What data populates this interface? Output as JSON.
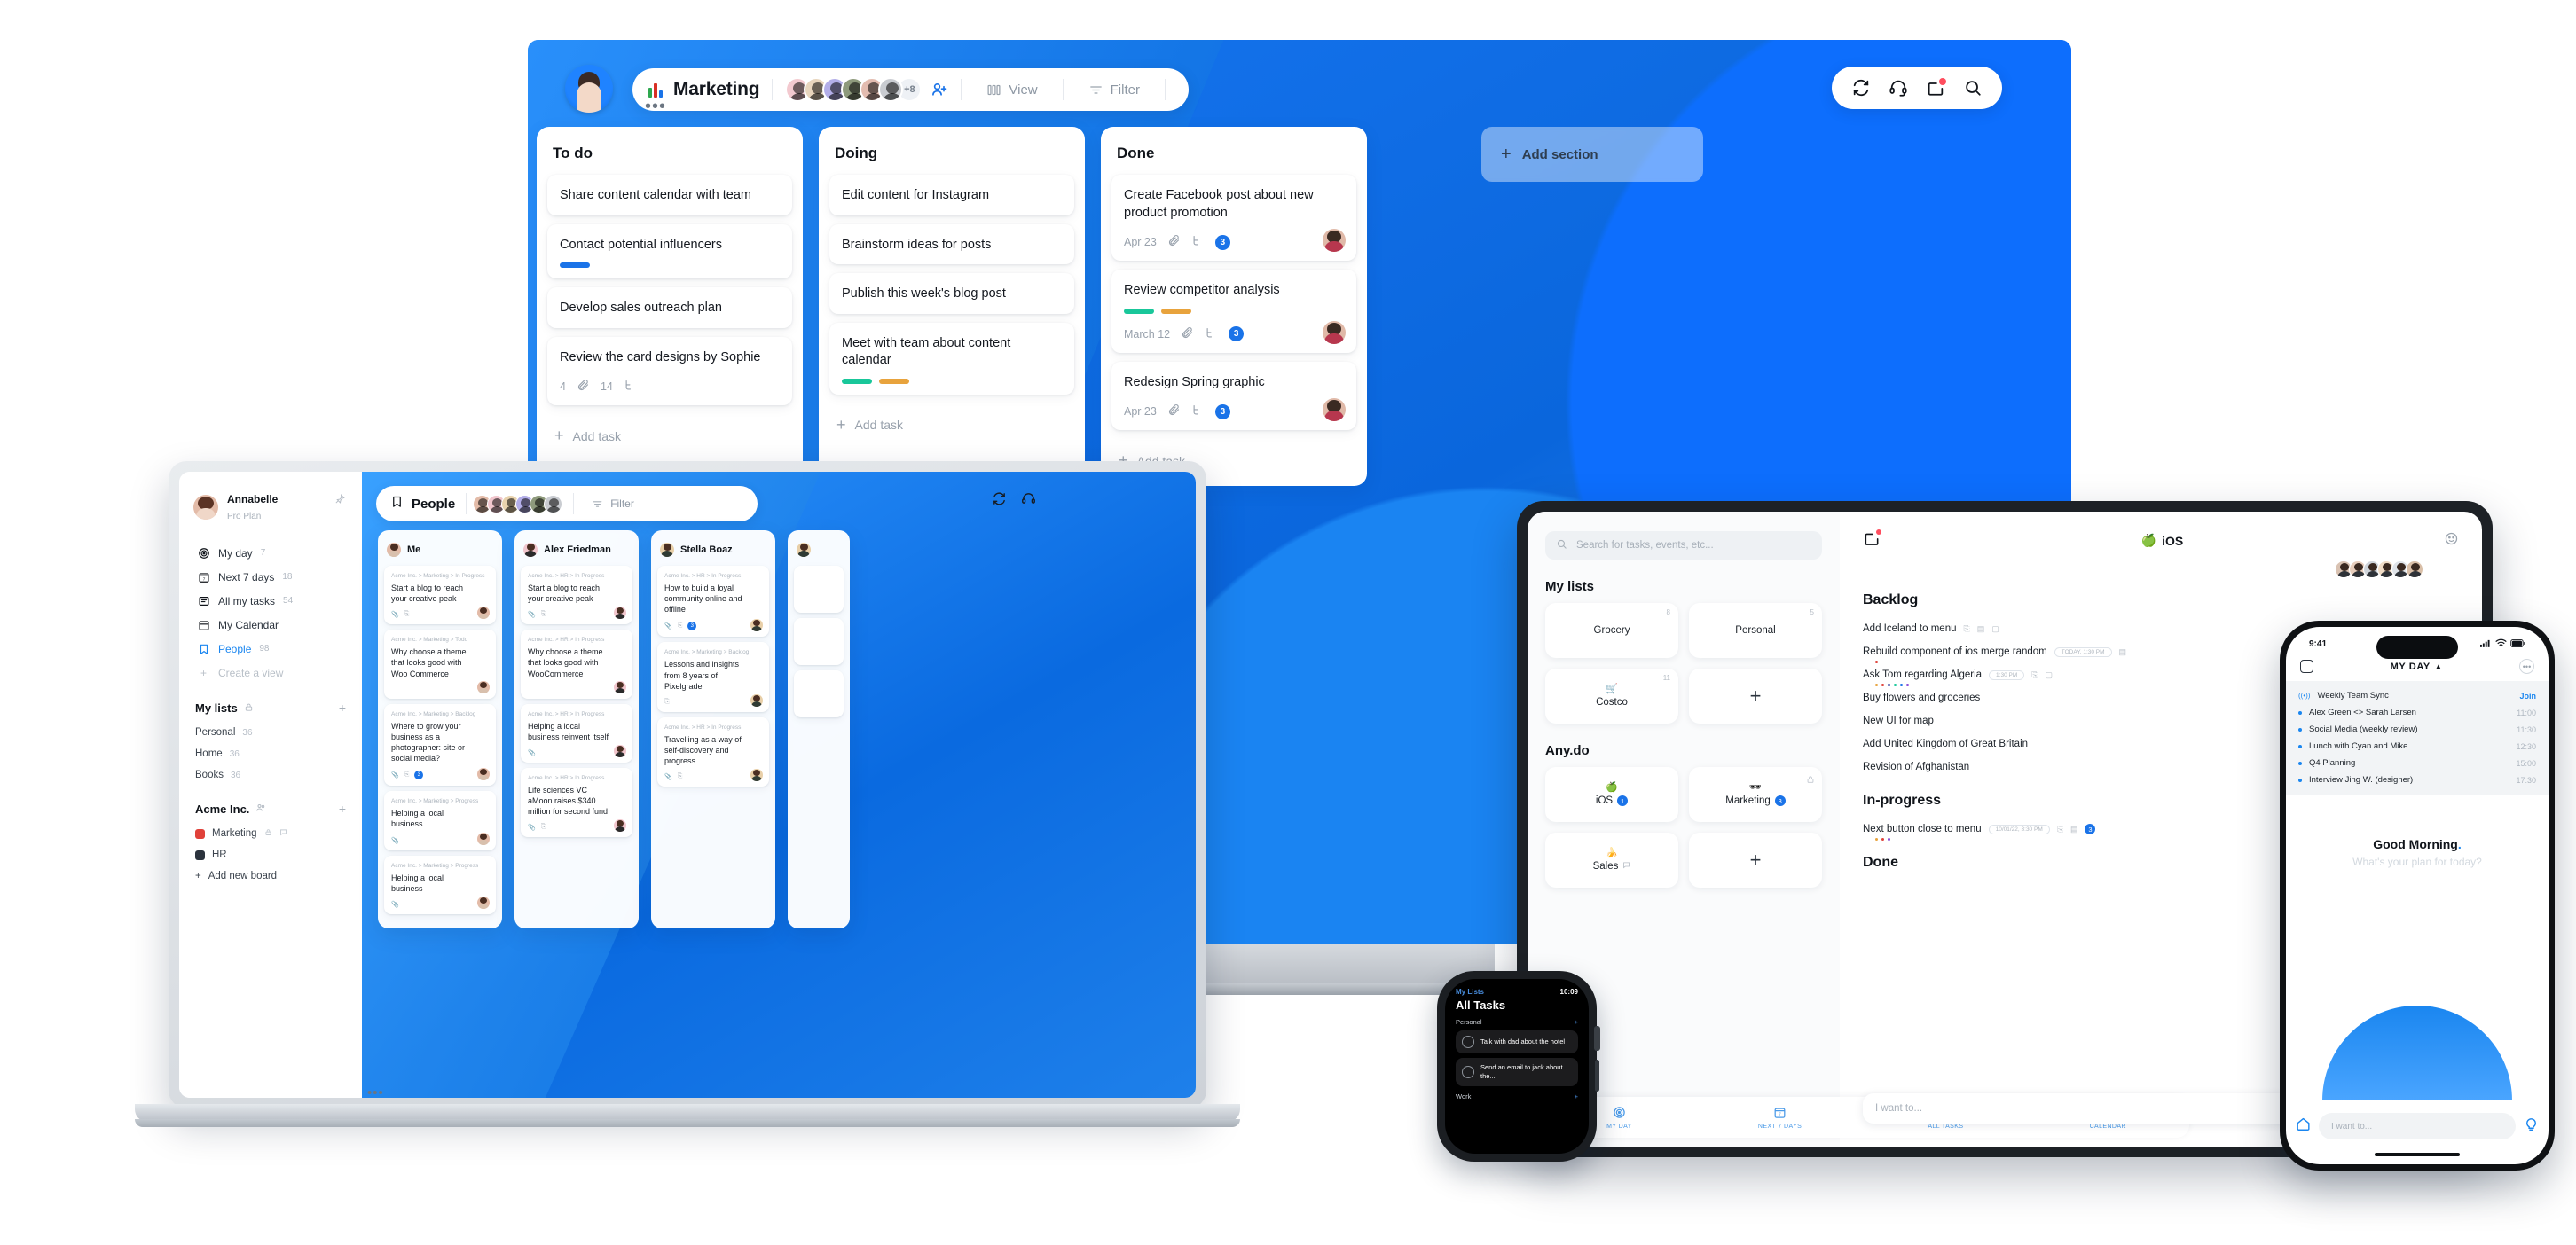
{
  "desktop": {
    "toolbar": {
      "board_title": "Marketing",
      "board_icon": "bar-chart-icon",
      "avatar_overflow": "+8",
      "add_person_icon": "add-person-icon",
      "view_label": "View",
      "filter_label": "Filter",
      "more_label": "•••"
    },
    "right_tools": [
      {
        "icon": "sync-icon",
        "name": "sync"
      },
      {
        "icon": "headset-icon",
        "name": "support"
      },
      {
        "icon": "inbox-icon",
        "name": "notifications"
      },
      {
        "icon": "search-icon",
        "name": "search"
      }
    ],
    "add_section_label": "Add section",
    "columns": [
      {
        "title": "To do",
        "cards": [
          {
            "title": "Share content calendar with team"
          },
          {
            "title": "Contact potential influencers",
            "chips": [
              "#1a73e8"
            ]
          },
          {
            "title": "Develop sales outreach plan"
          },
          {
            "title": "Review the card designs by Sophie",
            "meta": [
              "4",
              "14"
            ]
          }
        ],
        "add_label": "Add task"
      },
      {
        "title": "Doing",
        "cards": [
          {
            "title": "Edit content for Instagram"
          },
          {
            "title": "Brainstorm ideas for posts"
          },
          {
            "title": "Publish this week's blog post"
          },
          {
            "title": "Meet with team about content calendar",
            "chips": [
              "#19c79a",
              "#e8a33d"
            ]
          }
        ],
        "add_label": "Add task"
      },
      {
        "title": "Done",
        "cards": [
          {
            "title": "Create Facebook post about new product promotion",
            "date": "Apr 23",
            "comments": "3"
          },
          {
            "title": "Review competitor analysis",
            "chips": [
              "#19c79a",
              "#e8a33d"
            ],
            "date": "March 12",
            "comments": "3"
          },
          {
            "title": "Redesign Spring graphic",
            "date": "Apr 23",
            "comments": "3"
          }
        ],
        "add_label": "Add task"
      }
    ]
  },
  "laptop": {
    "sidebar": {
      "user_name": "Annabelle",
      "user_plan": "Pro Plan",
      "views": [
        {
          "label": "My day",
          "count": "7",
          "icon": "target-icon"
        },
        {
          "label": "Next 7 days",
          "count": "18",
          "icon": "calendar-7-icon"
        },
        {
          "label": "All my tasks",
          "count": "54",
          "icon": "list-icon"
        },
        {
          "label": "My Calendar",
          "count": "",
          "icon": "calendar-icon"
        },
        {
          "label": "People",
          "count": "98",
          "icon": "bookmark-icon"
        }
      ],
      "create_view_label": "Create a view",
      "my_lists_title": "My lists",
      "my_lists": [
        {
          "label": "Personal",
          "count": "36"
        },
        {
          "label": "Home",
          "count": "36"
        },
        {
          "label": "Books",
          "count": "36"
        }
      ],
      "workspace_title": "Acme Inc.",
      "boards": [
        {
          "label": "Marketing",
          "color": "#e0413a"
        },
        {
          "label": "HR",
          "color": "#2b333d"
        }
      ],
      "add_board_label": "Add new board"
    },
    "topbar": {
      "title": "People",
      "title_icon": "bookmark-icon",
      "filter_label": "Filter",
      "more_label": "•••"
    },
    "people": [
      {
        "name": "Me",
        "cards": [
          {
            "crumb": "Acme Inc. > Marketing > In Progress",
            "title": "Start a blog to reach your creative peak",
            "icons": [
              "attachment-icon",
              "subtask-icon"
            ]
          },
          {
            "crumb": "Acme Inc. > Marketing > Todo",
            "title": "Why choose a theme that looks good with Woo Commerce",
            "icons": []
          },
          {
            "crumb": "Acme Inc. > Marketing > Backlog",
            "title": "Where to grow your business as a photographer: site or social media?",
            "icons": [
              "attachment-icon",
              "subtask-icon"
            ],
            "badge": "3"
          },
          {
            "crumb": "Acme Inc. > Marketing > Progress",
            "title": "Helping a local business",
            "icons": [
              "attachment-icon"
            ]
          },
          {
            "crumb": "Acme Inc. > Marketing > Progress",
            "title": "Helping a local business",
            "icons": [
              "attachment-icon"
            ]
          }
        ]
      },
      {
        "name": "Alex Friedman",
        "cards": [
          {
            "crumb": "Acme Inc. > HR > In Progress",
            "title": "Start a blog to reach your creative peak",
            "icons": [
              "attachment-icon",
              "subtask-icon"
            ]
          },
          {
            "crumb": "Acme Inc. > HR > In Progress",
            "title": "Why choose a theme that looks good with WooCommerce",
            "icons": []
          },
          {
            "crumb": "Acme Inc. > HR > In Progress",
            "title": "Helping a local business reinvent itself",
            "icons": [
              "attachment-icon"
            ]
          },
          {
            "crumb": "Acme Inc. > HR > In Progress",
            "title": "Life sciences VC aMoon raises $340 million for second fund",
            "icons": [
              "attachment-icon",
              "subtask-icon"
            ]
          }
        ]
      },
      {
        "name": "Stella Boaz",
        "cards": [
          {
            "crumb": "Acme Inc. > HR > In Progress",
            "title": "How to build a loyal community online and offline",
            "icons": [
              "attachment-icon",
              "subtask-icon"
            ],
            "badge": "3"
          },
          {
            "crumb": "Acme Inc. > Marketing > Backlog",
            "title": "Lessons and insights from 8 years of Pixelgrade",
            "icons": [
              "subtask-icon"
            ]
          },
          {
            "crumb": "Acme Inc. > HR > In Progress",
            "title": "Travelling as a way of self-discovery and progress",
            "icons": [
              "attachment-icon",
              "subtask-icon"
            ]
          }
        ]
      }
    ]
  },
  "tablet": {
    "search_placeholder": "Search for tasks, events, etc...",
    "my_lists_title": "My lists",
    "my_lists": [
      {
        "label": "Grocery",
        "count": "8",
        "emoji": ""
      },
      {
        "label": "Personal",
        "count": "5",
        "emoji": ""
      },
      {
        "label": "Costco",
        "count": "11",
        "emoji": "🛒"
      },
      {
        "label": "",
        "count": "",
        "emoji": "",
        "add": true
      }
    ],
    "anydo_title": "Any.do",
    "anydo_lists": [
      {
        "label": "iOS",
        "emoji": "🍏",
        "badge": "1"
      },
      {
        "label": "Marketing",
        "emoji": "🕶",
        "badge": "3",
        "lock": true
      },
      {
        "label": "Sales",
        "emoji": "🍌",
        "comment": true
      },
      {
        "label": "",
        "add": true
      }
    ],
    "bottom_nav": [
      {
        "label": "MY DAY",
        "icon": "target-icon"
      },
      {
        "label": "NEXT 7 DAYS",
        "icon": "calendar-7-icon"
      },
      {
        "label": "ALL TASKS",
        "icon": "check-circle-icon"
      },
      {
        "label": "CALENDAR",
        "icon": "calendar-icon"
      }
    ],
    "board_title": "iOS",
    "board_emoji": "🍏",
    "sections": [
      {
        "title": "Backlog",
        "tasks": [
          {
            "title": "Add Iceland to menu",
            "icons": [
              "subtask-icon",
              "attachment-icon",
              "comment-icon"
            ]
          },
          {
            "title": "Rebuild component of ios merge random",
            "pill": "TODAY, 1:30 PM",
            "icons": [
              "attachment-icon"
            ],
            "dots": [
              "#e0413a"
            ]
          },
          {
            "title": "Ask Tom regarding Algeria",
            "pill": "1:30 PM",
            "icons": [
              "subtask-icon",
              "comment-icon"
            ],
            "dots": [
              "#e8a33d",
              "#e0413a",
              "#2e3d9e",
              "#19c79a",
              "#1a73e8",
              "#8a4ad6"
            ]
          },
          {
            "title": "Buy flowers and groceries",
            "icons": []
          },
          {
            "title": "New UI for map",
            "icons": []
          },
          {
            "title": "Add United Kingdom of Great Britain",
            "icons": []
          },
          {
            "title": "Revision of Afghanistan",
            "icons": []
          }
        ]
      },
      {
        "title": "In-progress",
        "tasks": [
          {
            "title": "Next button close to menu",
            "pill": "10/01/22, 3:30 PM",
            "icons": [
              "subtask-icon",
              "attachment-icon"
            ],
            "badge": "3",
            "dots": [
              "#e8a33d",
              "#e0413a",
              "#8a4ad6"
            ]
          }
        ]
      },
      {
        "title": "Done",
        "tasks": []
      }
    ],
    "input_placeholder": "I want to..."
  },
  "phone": {
    "status_time": "9:41",
    "header_title": "MY DAY",
    "events": [
      {
        "label": "Weekly Team Sync",
        "time": "",
        "action": "Join",
        "icon": "live-icon"
      },
      {
        "label": "Alex Green <> Sarah Larsen",
        "time": "11:00"
      },
      {
        "label": "Social Media (weekly review)",
        "time": "11:30"
      },
      {
        "label": "Lunch with Cyan and Mike",
        "time": "12:30"
      },
      {
        "label": "Q4 Planning",
        "time": "15:00"
      },
      {
        "label": "Interview Jing W. (designer)",
        "time": "17:30"
      }
    ],
    "greeting": "Good Morning",
    "greeting_sub": "What's your plan for today?",
    "input_placeholder": "I want to..."
  },
  "watch": {
    "back_label": "My Lists",
    "time": "10:09",
    "title": "All Tasks",
    "sections": [
      {
        "name": "Personal",
        "tasks": [
          {
            "title": "Talk with dad about the hotel"
          },
          {
            "title": "Send an email to jack about the..."
          }
        ]
      },
      {
        "name": "Work",
        "tasks": []
      }
    ]
  }
}
